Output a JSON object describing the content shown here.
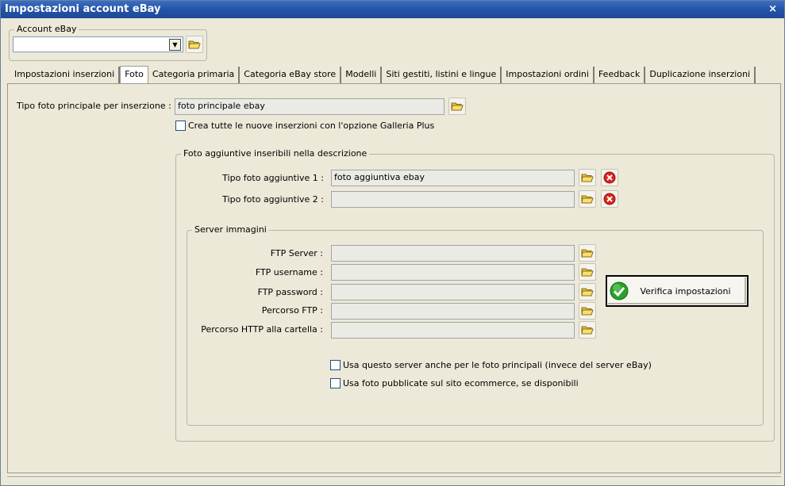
{
  "window": {
    "title": "Impostazioni account eBay",
    "close_label": "×"
  },
  "account": {
    "group_label": "Account eBay",
    "selected": ""
  },
  "tabs": [
    {
      "label": "Impostazioni inserzioni",
      "active": false
    },
    {
      "label": "Foto",
      "active": true
    },
    {
      "label": "Categoria primaria",
      "active": false
    },
    {
      "label": "Categoria eBay store",
      "active": false
    },
    {
      "label": "Modelli",
      "active": false
    },
    {
      "label": "Siti gestiti, listini e lingue",
      "active": false
    },
    {
      "label": "Impostazioni ordini",
      "active": false
    },
    {
      "label": "Feedback",
      "active": false
    },
    {
      "label": "Duplicazione inserzioni",
      "active": false
    }
  ],
  "foto": {
    "main_label": "Tipo foto principale per inserzione :",
    "main_value": "foto principale ebay",
    "gallery_plus_label": "Crea tutte le nuove inserzioni con l'opzione Galleria Plus",
    "gallery_plus_checked": false,
    "additional": {
      "group_label": "Foto aggiuntive inseribili nella descrizione",
      "row1_label": "Tipo foto aggiuntive 1 :",
      "row1_value": "foto aggiuntiva ebay",
      "row2_label": "Tipo foto aggiuntive 2 :",
      "row2_value": ""
    },
    "server": {
      "group_label": "Server immagini",
      "ftp_server_label": "FTP Server :",
      "ftp_server_value": "",
      "ftp_username_label": "FTP username :",
      "ftp_username_value": "",
      "ftp_password_label": "FTP password :",
      "ftp_password_value": "",
      "ftp_path_label": "Percorso FTP :",
      "ftp_path_value": "",
      "http_path_label": "Percorso HTTP alla cartella :",
      "http_path_value": "",
      "verify_button": "Verifica impostazioni",
      "use_server_main_label": "Usa questo server anche per le foto principali (invece del server eBay)",
      "use_server_main_checked": false,
      "use_ecommerce_label": "Usa foto pubblicate sul sito ecommerce, se disponibili",
      "use_ecommerce_checked": false
    }
  },
  "colors": {
    "folder": "#f2d24a",
    "delete": "#d9251c",
    "ok": "#2aa12a",
    "titlebar": "#2454a8"
  },
  "icons": {
    "folder": "folder-icon",
    "delete": "delete-icon",
    "check": "check-icon",
    "dropdown": "chevron-down-icon",
    "close": "close-icon"
  }
}
